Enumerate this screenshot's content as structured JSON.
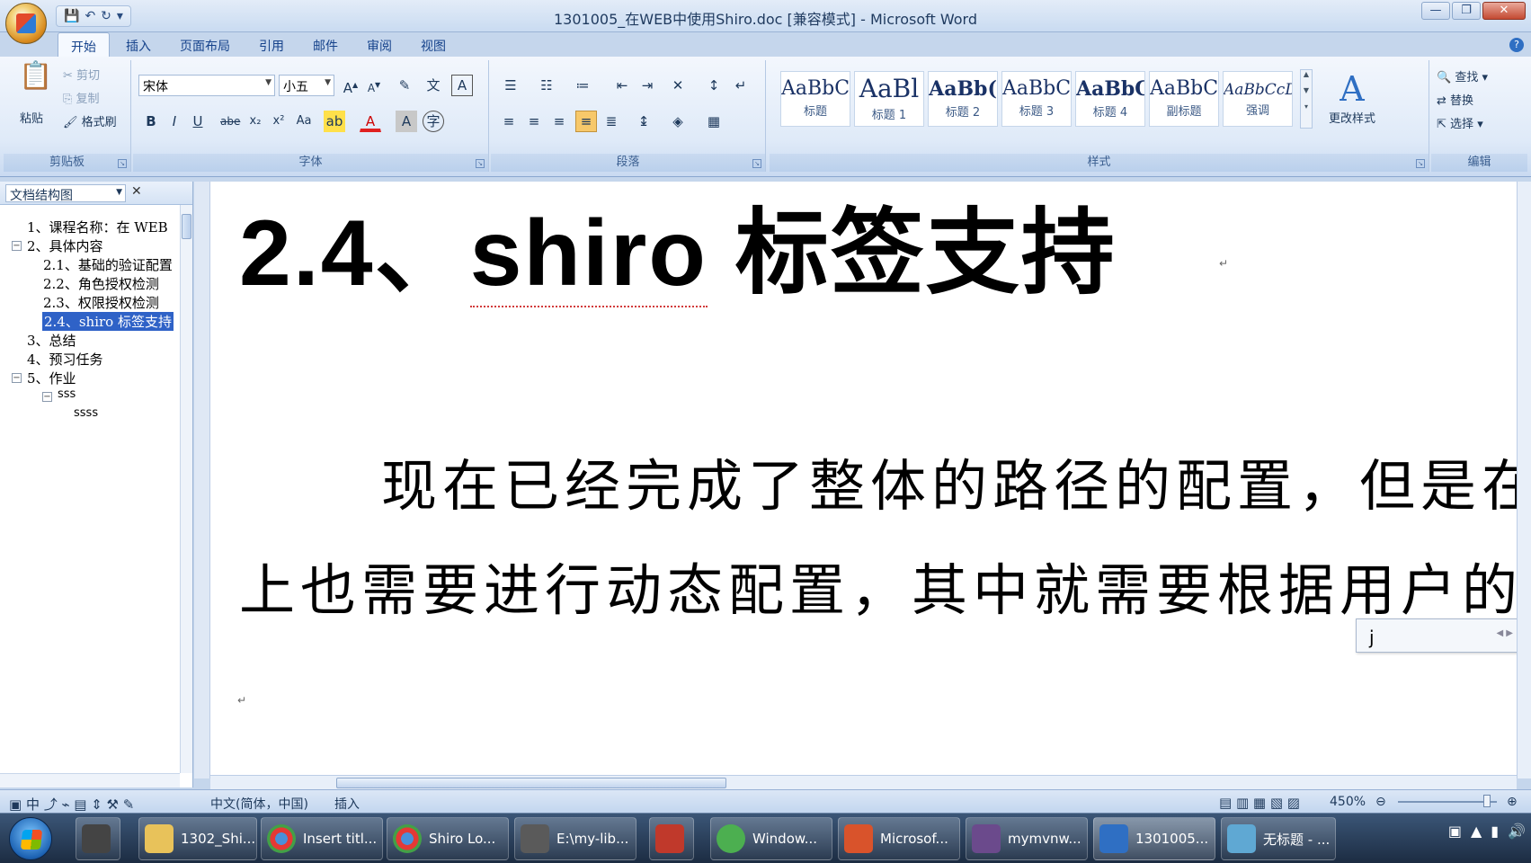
{
  "window": {
    "title": "1301005_在WEB中使用Shiro.doc [兼容模式] - Microsoft Word",
    "qat": [
      "save-icon",
      "undo-icon",
      "redo-icon",
      "customize-icon"
    ]
  },
  "tabs": [
    "开始",
    "插入",
    "页面布局",
    "引用",
    "邮件",
    "审阅",
    "视图"
  ],
  "ribbon": {
    "clipboard": {
      "label": "剪贴板",
      "paste": "粘贴",
      "cut": "剪切",
      "copy": "复制",
      "format_painter": "格式刷"
    },
    "font": {
      "label": "字体",
      "font_name": "宋体",
      "font_size": "小五",
      "bold": "B",
      "italic": "I",
      "underline": "U",
      "strike": "abe",
      "sub": "x₂",
      "sup": "x²",
      "case": "Aa",
      "color_a": "A"
    },
    "paragraph": {
      "label": "段落"
    },
    "styles": {
      "label": "样式",
      "items": [
        {
          "sample": "AaBbC",
          "name": "标题"
        },
        {
          "sample": "AaBl",
          "name": "标题 1"
        },
        {
          "sample": "AaBb(",
          "name": "标题 2"
        },
        {
          "sample": "AaBbC",
          "name": "标题 3"
        },
        {
          "sample": "AaBbC",
          "name": "标题 4"
        },
        {
          "sample": "AaBbC",
          "name": "副标题"
        },
        {
          "sample": "AaBbCcDi",
          "name": "强调"
        }
      ],
      "change_styles": "更改样式"
    },
    "editing": {
      "label": "编辑",
      "find": "查找",
      "replace": "替换",
      "select": "选择"
    }
  },
  "nav": {
    "view_select": "文档结构图",
    "items": [
      {
        "text": "1、课程名称：在 WEB"
      },
      {
        "text": "2、具体内容"
      },
      {
        "text": "2.1、基础的验证配置"
      },
      {
        "text": "2.2、角色授权检测"
      },
      {
        "text": "2.3、权限授权检测"
      },
      {
        "text": "2.4、shiro 标签支持"
      },
      {
        "text": "3、总结"
      },
      {
        "text": "4、预习任务"
      },
      {
        "text": "5、作业"
      },
      {
        "text": "sss"
      },
      {
        "text": "ssss"
      }
    ]
  },
  "document": {
    "heading_prefix": "2.4、",
    "heading_shiro": "shiro",
    "heading_suffix": " 标签支持",
    "line1": "现在已经完成了整体的路径的配置，但是在",
    "line2": "上也需要进行动态配置，其中就需要根据用户的",
    "ime_text": "j"
  },
  "status": {
    "language": "中文(简体，中国)",
    "mode": "插入",
    "zoom": "450%"
  },
  "taskbar": {
    "items": [
      {
        "label": "1302_Shi...",
        "color": "#e8c25a"
      },
      {
        "label": "Insert titl...",
        "color": "#4a90d9"
      },
      {
        "label": "Shiro Lo...",
        "color": "#4a90d9"
      },
      {
        "label": "E:\\my-lib...",
        "color": "#5a5a5a"
      },
      {
        "label": "Window...",
        "color": "#4caf50"
      },
      {
        "label": "Microsof...",
        "color": "#d9532b"
      },
      {
        "label": "mymvnw...",
        "color": "#6b4a8c"
      },
      {
        "label": "1301005...",
        "color": "#2f6fc3"
      },
      {
        "label": "无标题 - ...",
        "color": "#5fa8d3"
      }
    ]
  }
}
